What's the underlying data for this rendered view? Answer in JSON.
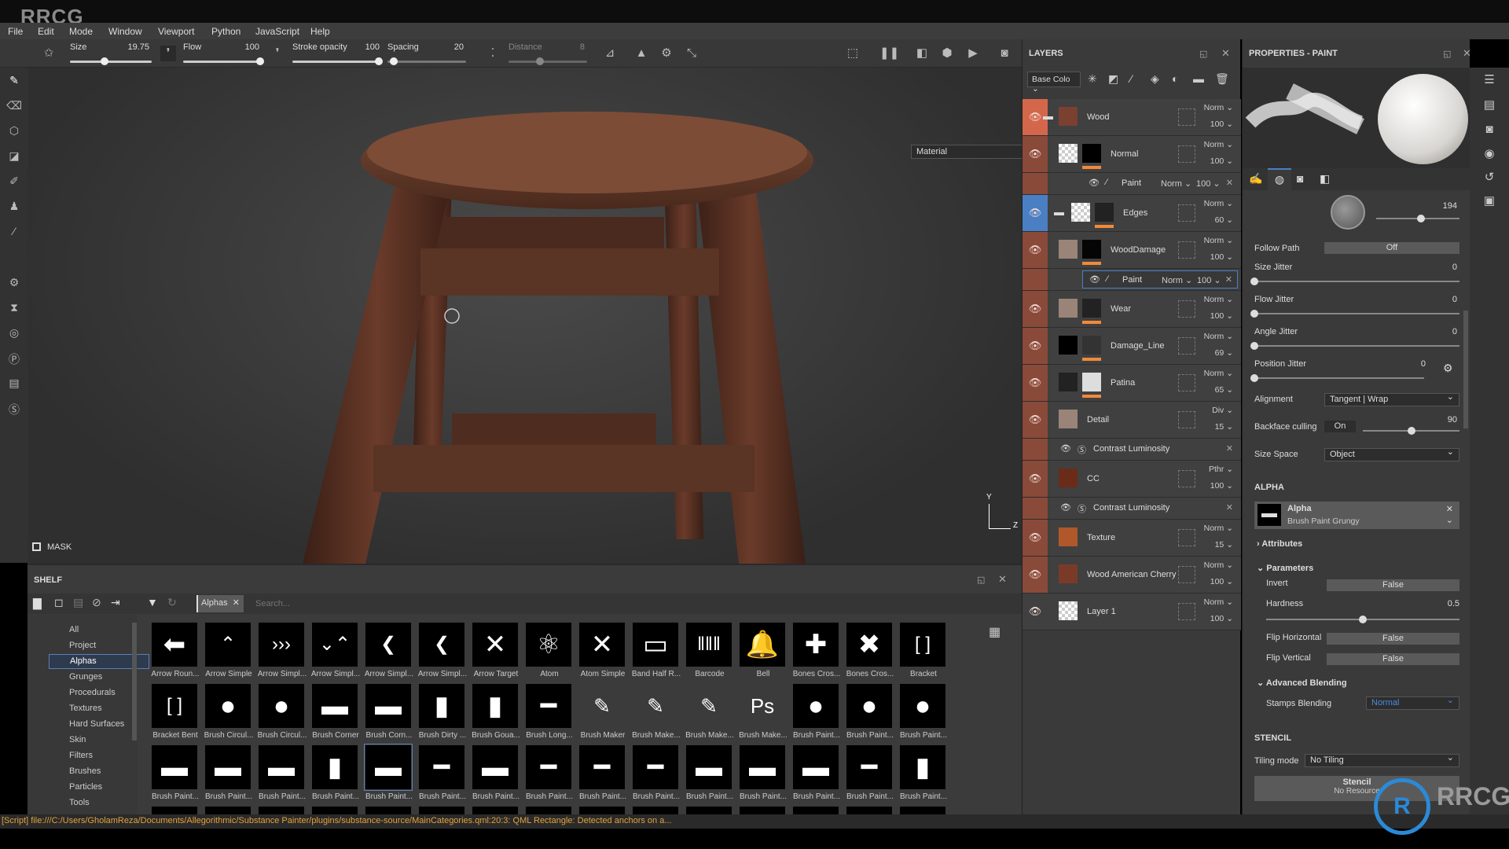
{
  "watermark": "RRCG",
  "menu": [
    "File",
    "Edit",
    "Mode",
    "Window",
    "Viewport",
    "Python",
    "JavaScript",
    "Help"
  ],
  "toolbar": {
    "size": {
      "label": "Size",
      "value": "19.75",
      "fraction": 0.42
    },
    "flow": {
      "label": "Flow",
      "value": "100",
      "fraction": 1.0
    },
    "stroke_opacity": {
      "label": "Stroke opacity",
      "value": "100",
      "fraction": 1.0
    },
    "spacing": {
      "label": "Spacing",
      "value": "20",
      "fraction": 0.08
    },
    "distance": {
      "label": "Distance",
      "value": "8",
      "fraction": 0.4
    }
  },
  "viewport": {
    "material_mode": "Material",
    "mask_label": "MASK",
    "axis_y": "Y",
    "axis_z": "Z"
  },
  "shelf": {
    "title": "SHELF",
    "filter_tag": "Alphas",
    "search_placeholder": "Search...",
    "categories": [
      "All",
      "Project",
      "Alphas",
      "Grunges",
      "Procedurals",
      "Textures",
      "Hard Surfaces",
      "Skin",
      "Filters",
      "Brushes",
      "Particles",
      "Tools"
    ],
    "selected_category": "Alphas",
    "rows": [
      [
        {
          "label": "Arrow Roun...",
          "icon": "arrow-left"
        },
        {
          "label": "Arrow Simple",
          "icon": "chevron-up"
        },
        {
          "label": "Arrow Simpl...",
          "icon": "chevrons-right"
        },
        {
          "label": "Arrow Simpl...",
          "icon": "chevrons-vertical"
        },
        {
          "label": "Arrow Simpl...",
          "icon": "chevron-left"
        },
        {
          "label": "Arrow Simpl...",
          "icon": "chevron-left-hatched"
        },
        {
          "label": "Arrow Target",
          "icon": "arrows-inward"
        },
        {
          "label": "Atom",
          "icon": "atom"
        },
        {
          "label": "Atom Simple",
          "icon": "atom-simple"
        },
        {
          "label": "Band Half R...",
          "icon": "band"
        },
        {
          "label": "Barcode",
          "icon": "barcode"
        },
        {
          "label": "Bell",
          "icon": "bell"
        },
        {
          "label": "Bones Cros...",
          "icon": "bones-cross"
        },
        {
          "label": "Bones Cros...",
          "icon": "bones-x"
        },
        {
          "label": "Bracket",
          "icon": "bracket"
        }
      ],
      [
        {
          "label": "Bracket Bent",
          "icon": "bracket"
        },
        {
          "label": "Brush Circul...",
          "icon": "circle-brush"
        },
        {
          "label": "Brush Circul...",
          "icon": "circle-brush"
        },
        {
          "label": "Brush Corner",
          "icon": "stroke"
        },
        {
          "label": "Brush Corn...",
          "icon": "stroke"
        },
        {
          "label": "Brush Dirty ...",
          "icon": "stroke-vertical"
        },
        {
          "label": "Brush Goua...",
          "icon": "stroke-vertical"
        },
        {
          "label": "Brush Long...",
          "icon": "stroke-thin"
        },
        {
          "label": "Brush Maker",
          "icon": "brush-maker"
        },
        {
          "label": "Brush Make...",
          "icon": "brush-maker"
        },
        {
          "label": "Brush Make...",
          "icon": "brush-maker"
        },
        {
          "label": "Brush Make...",
          "icon": "brush-maker-ps"
        },
        {
          "label": "Brush Paint...",
          "icon": "circle-brush"
        },
        {
          "label": "Brush Paint...",
          "icon": "circle-brush"
        },
        {
          "label": "Brush Paint...",
          "icon": "circle-brush"
        }
      ],
      [
        {
          "label": "Brush Paint...",
          "icon": "stroke"
        },
        {
          "label": "Brush Paint...",
          "icon": "stroke"
        },
        {
          "label": "Brush Paint...",
          "icon": "stroke"
        },
        {
          "label": "Brush Paint...",
          "icon": "stroke-vertical"
        },
        {
          "label": "Brush Paint...",
          "icon": "stroke",
          "selected": true
        },
        {
          "label": "Brush Paint...",
          "icon": "stroke-thin"
        },
        {
          "label": "Brush Paint...",
          "icon": "stroke"
        },
        {
          "label": "Brush Paint...",
          "icon": "stroke-thin"
        },
        {
          "label": "Brush Paint...",
          "icon": "stroke-thin"
        },
        {
          "label": "Brush Paint...",
          "icon": "stroke-thin"
        },
        {
          "label": "Brush Paint...",
          "icon": "stroke"
        },
        {
          "label": "Brush Paint...",
          "icon": "stroke"
        },
        {
          "label": "Brush Paint...",
          "icon": "stroke"
        },
        {
          "label": "Brush Paint...",
          "icon": "stroke-thin"
        },
        {
          "label": "Brush Paint...",
          "icon": "stroke-vertical"
        }
      ]
    ]
  },
  "status": "[Script] file:///C:/Users/GholamReza/Documents/Allegorithmic/Substance Painter/plugins/substance-source/MainCategories.qml:20:3: QML Rectangle: Detected anchors on a...",
  "layers": {
    "title": "LAYERS",
    "channel": "Base Colo",
    "items": [
      {
        "kind": "layer",
        "name": "Wood",
        "blend": "Norm",
        "opacity": "100",
        "eye_color": "#d4674b",
        "folder": true,
        "thumb": "#7a4030"
      },
      {
        "kind": "layer",
        "name": "Normal",
        "blend": "Norm",
        "opacity": "100",
        "eye_color": "#8a4a3a",
        "thumb": "checker",
        "mask": "#000"
      },
      {
        "kind": "effect",
        "name": "Paint",
        "blend": "Norm",
        "opacity": "100",
        "eye_color": "#8a4a3a",
        "icon": "brush"
      },
      {
        "kind": "layer",
        "name": "Edges",
        "blend": "Norm",
        "opacity": "60",
        "eye_color": "#4a7fc4",
        "folder": true,
        "thumb": "checker",
        "mask": "#222"
      },
      {
        "kind": "layer",
        "name": "WoodDamage",
        "blend": "Norm",
        "opacity": "100",
        "eye_color": "#8a4a3a",
        "thumb": "#9a8478",
        "mask": "#050505"
      },
      {
        "kind": "effect",
        "name": "Paint",
        "blend": "Norm",
        "opacity": "100",
        "eye_color": "#8a4a3a",
        "icon": "brush",
        "selected": true
      },
      {
        "kind": "layer",
        "name": "Wear",
        "blend": "Norm",
        "opacity": "100",
        "eye_color": "#8a4a3a",
        "thumb": "#9a8478",
        "mask": "#222"
      },
      {
        "kind": "layer",
        "name": "Damage_Line",
        "blend": "Norm",
        "opacity": "69",
        "eye_color": "#8a4a3a",
        "thumb": "#000",
        "mask": "#333"
      },
      {
        "kind": "layer",
        "name": "Patina",
        "blend": "Norm",
        "opacity": "65",
        "eye_color": "#8a4a3a",
        "thumb": "#222",
        "mask": "#ddd"
      },
      {
        "kind": "layer",
        "name": "Detail",
        "blend": "Div",
        "opacity": "15",
        "eye_color": "#8a4a3a",
        "thumb": "#9a8478"
      },
      {
        "kind": "effect",
        "name": "Contrast Luminosity",
        "eye_color": "#8a4a3a",
        "icon": "substance"
      },
      {
        "kind": "layer",
        "name": "CC",
        "blend": "Pthr",
        "opacity": "100",
        "eye_color": "#8a4a3a",
        "thumb": "#6a2c18"
      },
      {
        "kind": "effect",
        "name": "Contrast Luminosity",
        "eye_color": "#8a4a3a",
        "icon": "substance"
      },
      {
        "kind": "layer",
        "name": "Texture",
        "blend": "Norm",
        "opacity": "15",
        "eye_color": "#8a4a3a",
        "thumb": "#b0582a"
      },
      {
        "kind": "layer",
        "name": "Wood American Cherry",
        "blend": "Norm",
        "opacity": "100",
        "eye_color": "#8a4a3a",
        "thumb": "#7a3a28"
      },
      {
        "kind": "layer",
        "name": "Layer 1",
        "blend": "Norm",
        "opacity": "100",
        "eye_color": "#404040",
        "thumb": "checker"
      }
    ]
  },
  "properties": {
    "title": "PROPERTIES - PAINT",
    "angle": {
      "value": "194",
      "fraction": 0.54
    },
    "follow_path": {
      "label": "Follow Path",
      "value": "Off"
    },
    "size_jitter": {
      "label": "Size Jitter",
      "value": "0",
      "fraction": 0
    },
    "flow_jitter": {
      "label": "Flow Jitter",
      "value": "0",
      "fraction": 0
    },
    "angle_jitter": {
      "label": "Angle Jitter",
      "value": "0",
      "fraction": 0
    },
    "position_jitter": {
      "label": "Position Jitter",
      "value": "0",
      "fraction": 0
    },
    "alignment": {
      "label": "Alignment",
      "value": "Tangent | Wrap"
    },
    "backface": {
      "label": "Backface culling",
      "toggle": "On",
      "value": "90",
      "fraction": 0.5
    },
    "size_space": {
      "label": "Size Space",
      "value": "Object"
    },
    "alpha_header": "ALPHA",
    "alpha": {
      "title": "Alpha",
      "resource": "Brush Paint Grungy"
    },
    "attributes": "Attributes",
    "parameters": "Parameters",
    "invert": {
      "label": "Invert",
      "value": "False"
    },
    "hardness": {
      "label": "Hardness",
      "value": "0.5",
      "fraction": 0.5
    },
    "flip_h": {
      "label": "Flip Horizontal",
      "value": "False"
    },
    "flip_v": {
      "label": "Flip Vertical",
      "value": "False"
    },
    "advanced_blending": "Advanced Blending",
    "stamps_blending": {
      "label": "Stamps Blending",
      "value": "Normal"
    },
    "stencil_header": "STENCIL",
    "tiling": {
      "label": "Tiling mode",
      "value": "No Tiling"
    },
    "stencil": {
      "title": "Stencil",
      "resource": "No Resource"
    },
    "accent": "#4a7fc4"
  }
}
